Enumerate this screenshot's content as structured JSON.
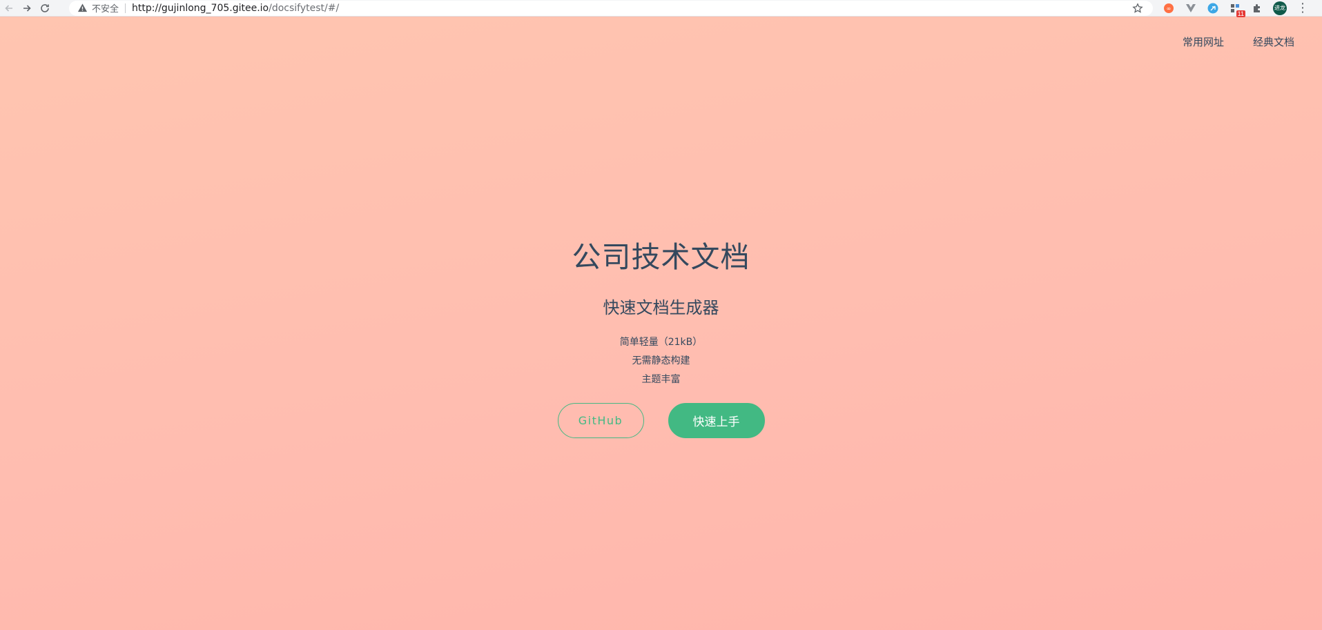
{
  "browser": {
    "insecure_label": "不安全",
    "url_host": "http://gujinlong_705.gitee.io",
    "url_path": "/docsifytest/#/",
    "avatar_text": "进龙",
    "ext_badge": "11"
  },
  "nav": {
    "items": [
      {
        "label": "常用网址"
      },
      {
        "label": "经典文档"
      }
    ]
  },
  "cover": {
    "title": "公司技术文档",
    "subtitle": "快速文档生成器",
    "features": [
      "简单轻量（21kB）",
      "无需静态构建",
      "主题丰富"
    ],
    "buttons": {
      "github": "GitHub",
      "start": "快速上手"
    }
  },
  "colors": {
    "accent": "#42b983",
    "text": "#34495e",
    "background": "#ffbfb1"
  }
}
